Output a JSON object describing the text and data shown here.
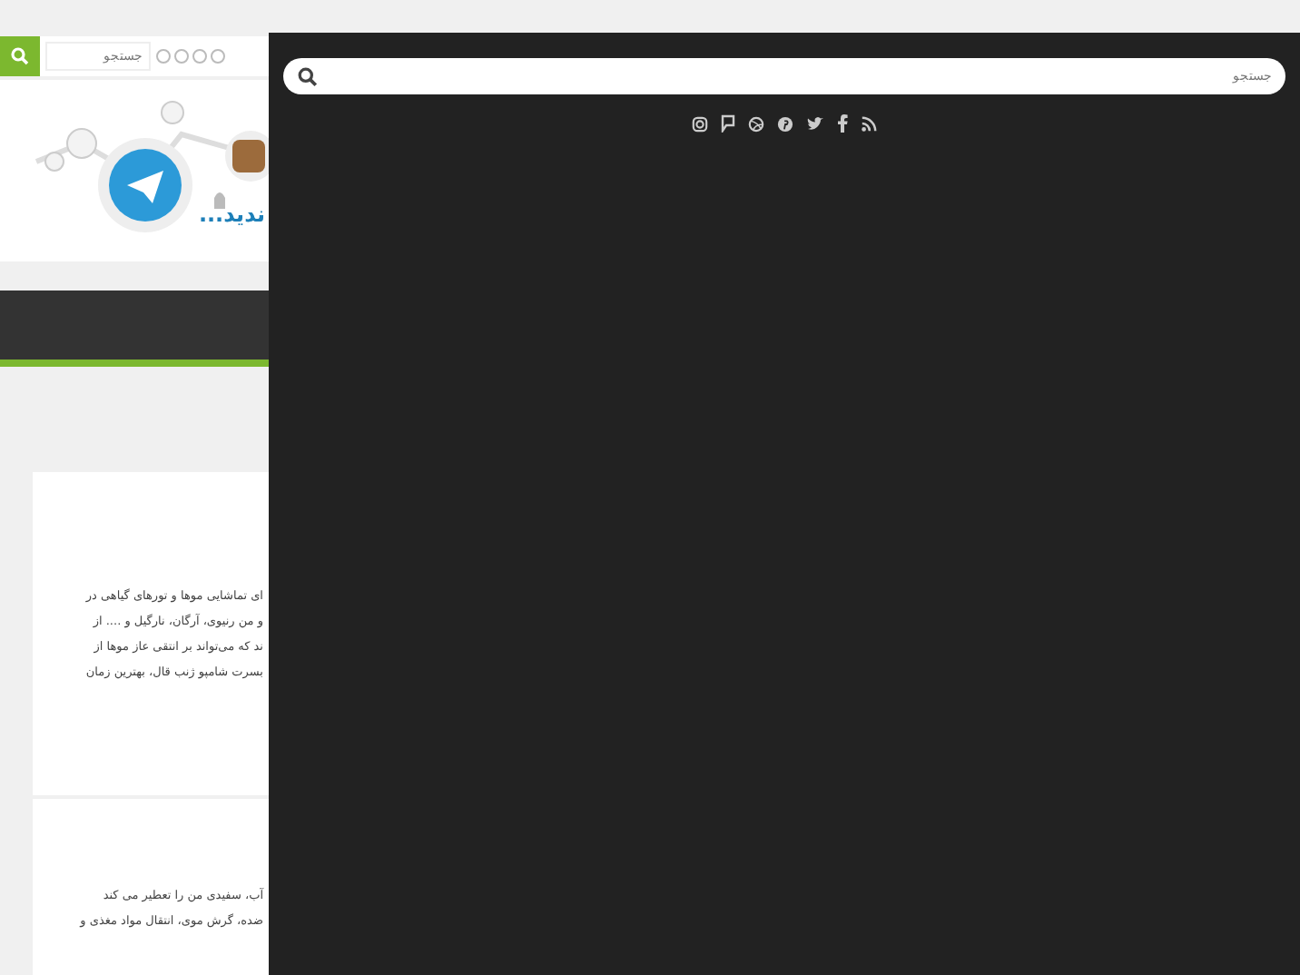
{
  "page": {
    "search": {
      "placeholder": "جستجو"
    },
    "banner": {
      "caption": "...ندید"
    },
    "articles": [
      {
        "lines": [
          "ای تماشایی موها و تورهای گیاهی در",
          "و من رنیوی، آرگان، نارگیل و .... از",
          "ند که می‌تواند بر انتقی عاز موها از",
          "بسرت شامپو ژنب قال، بهترین زمان"
        ]
      },
      {
        "lines": [
          "آب، سفیدی من را تعطیر می کند",
          "ضده، گرش موی، انتقال مواد مغذی و"
        ]
      }
    ]
  },
  "overlay": {
    "search": {
      "placeholder": "جستجو"
    }
  }
}
